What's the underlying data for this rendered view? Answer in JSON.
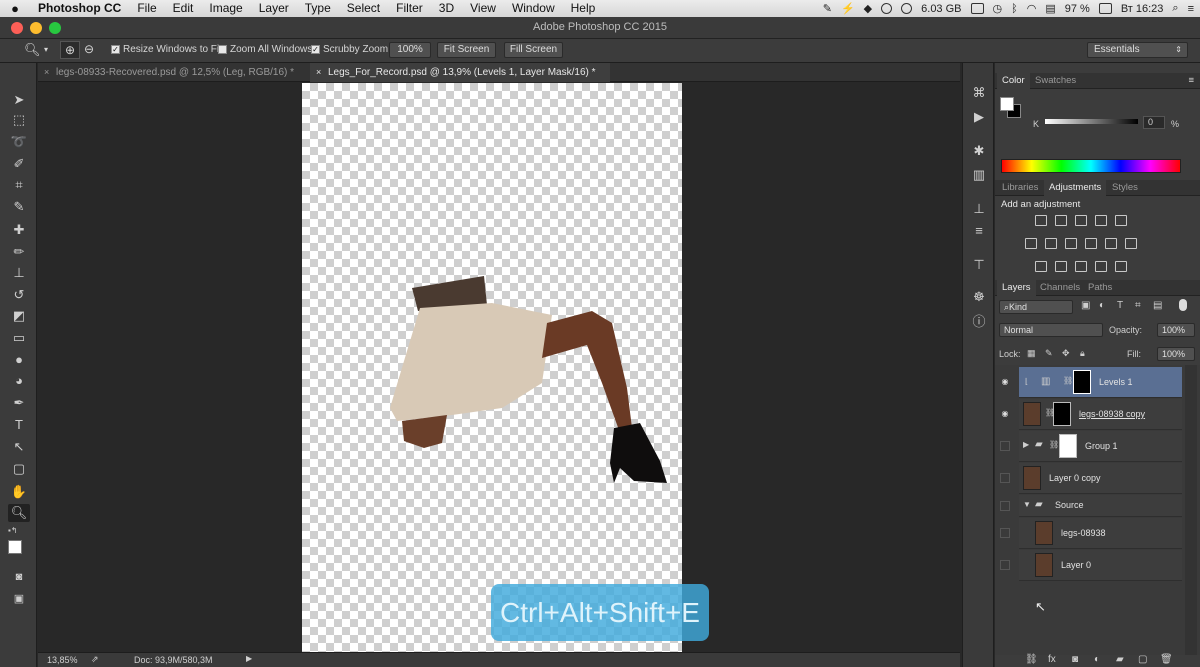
{
  "menubar": {
    "apple": "",
    "app_name": "Photoshop CC",
    "items": [
      "File",
      "Edit",
      "Image",
      "Layer",
      "Type",
      "Select",
      "Filter",
      "3D",
      "View",
      "Window",
      "Help"
    ],
    "memory": "6.03 GB",
    "battery": "97 %",
    "clock": "Вт 16:23"
  },
  "window": {
    "title": "Adobe Photoshop CC 2015"
  },
  "options": {
    "resize_windows": "Resize Windows to Fit",
    "zoom_all": "Zoom All Windows",
    "scrubby_zoom": "Scrubby Zoom",
    "zoom_100": "100%",
    "fit_screen": "Fit Screen",
    "fill_screen": "Fill Screen",
    "workspace": "Essentials"
  },
  "tabs": [
    {
      "label": "legs-08933-Recovered.psd @ 12,5% (Leg, RGB/16) *",
      "active": false
    },
    {
      "label": "Legs_For_Record.psd @ 13,9% (Levels 1, Layer Mask/16) *",
      "active": true
    }
  ],
  "overlay": {
    "text": "Ctrl+Alt+Shift+E"
  },
  "status": {
    "zoom": "13,85%",
    "doc": "Doc: 93,9M/580,3M"
  },
  "color_panel": {
    "tabs": [
      "Color",
      "Swatches"
    ],
    "channel": "K",
    "value": "0",
    "unit": "%"
  },
  "adjustments_panel": {
    "tabs": [
      "Libraries",
      "Adjustments",
      "Styles"
    ],
    "heading": "Add an adjustment"
  },
  "layers_panel": {
    "tabs": [
      "Layers",
      "Channels",
      "Paths"
    ],
    "filter_kind": "Kind",
    "blend_mode": "Normal",
    "opacity_label": "Opacity:",
    "opacity": "100%",
    "lock_label": "Lock:",
    "fill_label": "Fill:",
    "fill": "100%",
    "layers": [
      {
        "name": "Levels 1",
        "visible": true,
        "selected": true
      },
      {
        "name": "legs-08938 copy",
        "visible": true,
        "selected": false
      },
      {
        "name": "Group 1",
        "visible": false,
        "selected": false
      },
      {
        "name": "Layer 0 copy",
        "visible": false,
        "selected": false
      },
      {
        "name": "Source",
        "visible": false,
        "selected": false
      },
      {
        "name": "legs-08938",
        "visible": false,
        "selected": false
      },
      {
        "name": "Layer 0",
        "visible": false,
        "selected": false
      }
    ]
  },
  "colors": {
    "selected_layer": "#5a6f93",
    "overlay": "#40aadc"
  }
}
